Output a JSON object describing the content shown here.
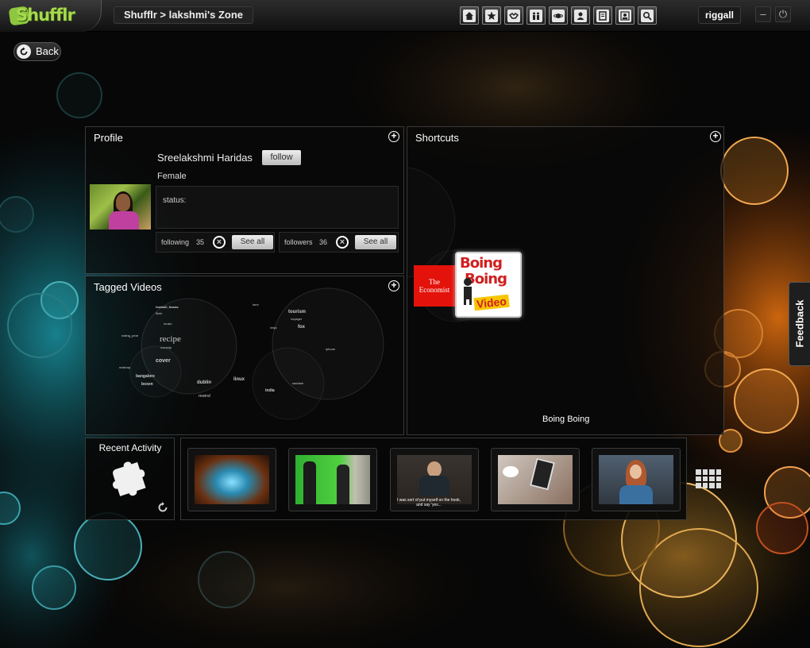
{
  "app": {
    "logo": "Shufflr"
  },
  "header": {
    "breadcrumb": "Shufflr > lakshmi's Zone",
    "user": "riggall",
    "minimize": "–",
    "power": "⏻"
  },
  "nav": {
    "icons": [
      "home-icon",
      "star-icon",
      "handshake-icon",
      "people-icon",
      "planet-icon",
      "user-badge-icon",
      "notes-icon",
      "profile-icon",
      "search-icon"
    ]
  },
  "back_label": "Back",
  "profile": {
    "title": "Profile",
    "name": "Sreelakshmi Haridas",
    "follow_label": "follow",
    "gender": "Female",
    "status_label": "status:",
    "following_label": "following",
    "following_count": "35",
    "followers_label": "followers",
    "followers_count": "36",
    "see_all": "See all"
  },
  "tagged": {
    "title": "Tagged Videos",
    "tags": [
      "recipe",
      "cover",
      "tourism",
      "fox",
      "dublin",
      "boxen",
      "linux",
      "rewind",
      "india",
      "football_fmana",
      "mashup",
      "bangalore",
      "music",
      "ninja",
      "iphone",
      "comedy",
      "saddam",
      "voyager",
      "kent",
      "flickr",
      "eating_pear"
    ]
  },
  "shortcuts": {
    "title": "Shortcuts",
    "items": [
      {
        "name": "The Economist"
      },
      {
        "name": "Boing Boing"
      }
    ],
    "economist_line1": "The",
    "economist_line2": "Economist",
    "boing_line1": "Boing",
    "boing_line2": "Boing",
    "boing_line3": "Video",
    "hover_label": "Boing Boing"
  },
  "recent": {
    "title": "Recent  Activity",
    "thumbs": [
      {
        "caption": ""
      },
      {
        "caption": ""
      },
      {
        "caption": "I was sort of put myself on the hook, and say 'yes..."
      },
      {
        "caption": ""
      },
      {
        "caption": ""
      }
    ]
  },
  "feedback_label": "Feedback",
  "colors": {
    "brand_green": "#8dc63f",
    "economist_red": "#e3120b",
    "boing_red": "#d02020",
    "boing_yellow": "#f7c600"
  }
}
